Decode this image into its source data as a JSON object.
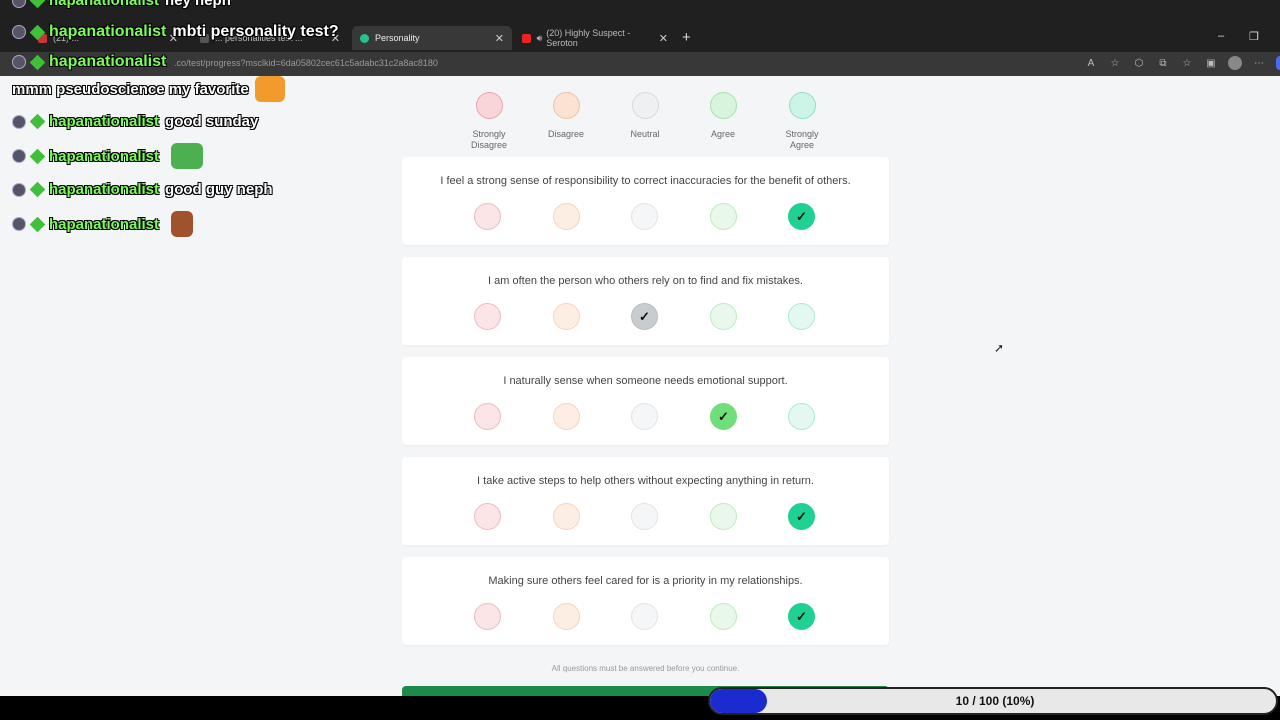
{
  "browser": {
    "tabs": [
      {
        "label": "(21) ... ",
        "active": false
      },
      {
        "label": "... personalities test ...",
        "active": false
      },
      {
        "label": "Personality",
        "active": true
      },
      {
        "label": "(20) Highly Suspect - Seroton",
        "active": false
      }
    ],
    "url": ".co/test/progress?msclkid=6da05802cec61c5adabc31c2a8ac8180"
  },
  "chat": {
    "messages": [
      {
        "user": "hapanationalist",
        "text": "hey neph"
      },
      {
        "user": "hapanationalist",
        "text": "mbti personality test?"
      },
      {
        "user": "hapanationalist",
        "text": ""
      },
      {
        "user": "",
        "text": "mmm pseudoscience my favorite"
      },
      {
        "user": "hapanationalist",
        "text": "good sunday"
      },
      {
        "user": "hapanationalist",
        "text": ""
      },
      {
        "user": "hapanationalist",
        "text": "good guy neph"
      },
      {
        "user": "hapanationalist",
        "text": ""
      }
    ]
  },
  "scale": {
    "labels": [
      "Strongly Disagree",
      "Disagree",
      "Neutral",
      "Agree",
      "Strongly Agree"
    ]
  },
  "questions": [
    {
      "text": "I feel a strong sense of responsibility to correct inaccuracies for the benefit of others.",
      "selected": 5
    },
    {
      "text": "I am often the person who others rely on to find and fix mistakes.",
      "selected": 3
    },
    {
      "text": "I naturally sense when someone needs emotional support.",
      "selected": 4
    },
    {
      "text": "I take active steps to help others without expecting anything in return.",
      "selected": 5
    },
    {
      "text": "Making sure others feel cared for is a priority in my relationships.",
      "selected": 5
    }
  ],
  "footer": {
    "note": "All questions must be answered before you continue."
  },
  "progress": {
    "text": "10 / 100 (10%)",
    "fraction": 0.1
  },
  "icons": {
    "check": "check-icon",
    "cursor": "mouse-cursor-icon"
  }
}
